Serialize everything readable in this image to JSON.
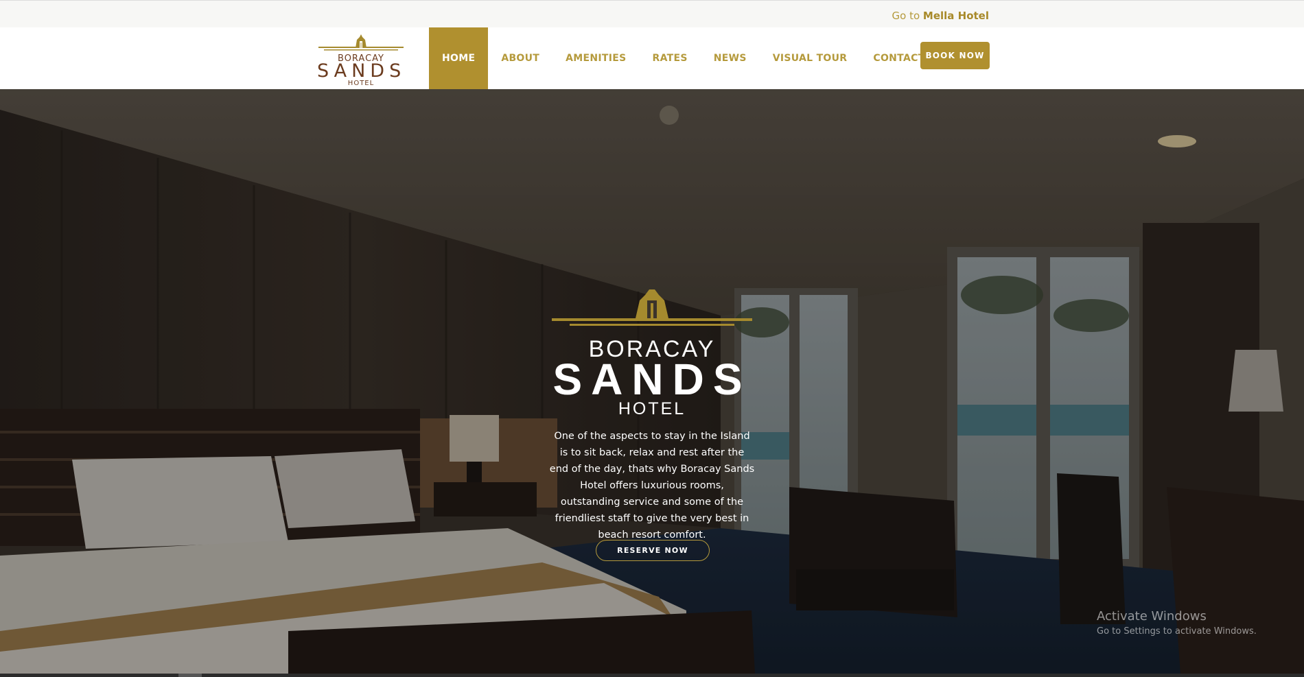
{
  "topbar": {
    "prefix": "Go to",
    "link": "Mella Hotel"
  },
  "logo": {
    "line1": "BORACAY",
    "line2": "SANDS",
    "line3": "HOTEL"
  },
  "nav": {
    "items": [
      "HOME",
      "ABOUT",
      "AMENITIES",
      "RATES",
      "NEWS",
      "VISUAL TOUR",
      "CONTACT"
    ],
    "active": "HOME"
  },
  "book_button": "BOOK NOW",
  "hero": {
    "logo": {
      "line1": "BORACAY",
      "line2": "SANDS",
      "line3": "HOTEL"
    },
    "tagline": "One of the aspects to stay in the Island is to sit back, relax and rest after the end of the day, thats why Boracay Sands Hotel offers luxurious rooms, outstanding service and some of the friendliest staff to give the very best in beach resort comfort.",
    "cta": "RESERVE NOW"
  },
  "watermark": {
    "title": "Activate Windows",
    "subtitle": "Go to Settings to activate Windows."
  },
  "colors": {
    "gold": "#b0902f",
    "brown": "#6b3b1e"
  }
}
